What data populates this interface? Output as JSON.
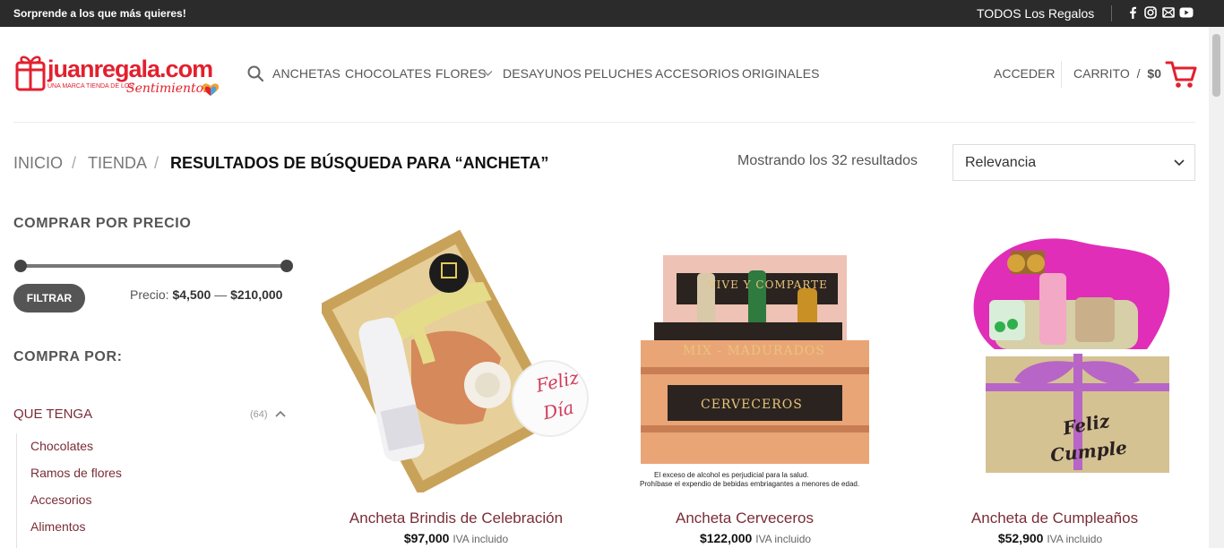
{
  "topbar": {
    "promo": "Sorprende a los que más quieres!",
    "all_gifts": "TODOS Los Regalos",
    "social": [
      "facebook-icon",
      "instagram-icon",
      "email-icon",
      "youtube-icon"
    ]
  },
  "logo": {
    "word": "juanregala.com",
    "tag": "UNA MARCA TIENDA DE LOS",
    "script": "Sentimientos"
  },
  "nav": {
    "items": [
      "ANCHETAS",
      "CHOCOLATES",
      "FLORES",
      "DESAYUNOS",
      "PELUCHES",
      "ACCESORIOS",
      "ORIGINALES"
    ],
    "login": "ACCEDER",
    "cart_label": "CARRITO",
    "cart_divider": "/",
    "cart_total": "$0"
  },
  "breadcrumb": {
    "home": "INICIO",
    "shop": "TIENDA",
    "current": "RESULTADOS DE BÚSQUEDA PARA “ANCHETA”",
    "separator": "/"
  },
  "results": {
    "count_text": "Mostrando los 32 resultados",
    "sort_selected": "Relevancia"
  },
  "sidebar": {
    "price_title": "COMPRAR POR PRECIO",
    "filter_button": "FILTRAR",
    "price_label": "Precio:",
    "price_min": "$4,500",
    "price_dash": "—",
    "price_max": "$210,000",
    "shop_by_title": "COMPRA POR:",
    "category": {
      "label": "QUE TENGA",
      "count": "(64)",
      "items": [
        "Chocolates",
        "Ramos de flores",
        "Accesorios",
        "Alimentos"
      ]
    }
  },
  "products": [
    {
      "title": "Ancheta Brindis de Celebración",
      "price": "$97,000",
      "tax": "IVA incluido"
    },
    {
      "title": "Ancheta Cerveceros",
      "price": "$122,000",
      "tax": "IVA incluido",
      "image_text": [
        "VIVE Y COMPARTE",
        "MIX - MADURADOS",
        "CERVECEROS",
        "El exceso de alcohol es perjudicial para la salud.",
        "Prohíbase el expendio de bebidas embriagantes a menores de edad."
      ]
    },
    {
      "title": "Ancheta de Cumpleaños",
      "price": "$52,900",
      "tax": "IVA incluido",
      "image_text": [
        "Feliz",
        "Cumple"
      ]
    }
  ],
  "product1_image_text": [
    "Feliz",
    "Día"
  ],
  "colors": {
    "brand_red": "#e3202e",
    "link_maroon": "#7a2d37",
    "topbar": "#2b2b2b"
  }
}
